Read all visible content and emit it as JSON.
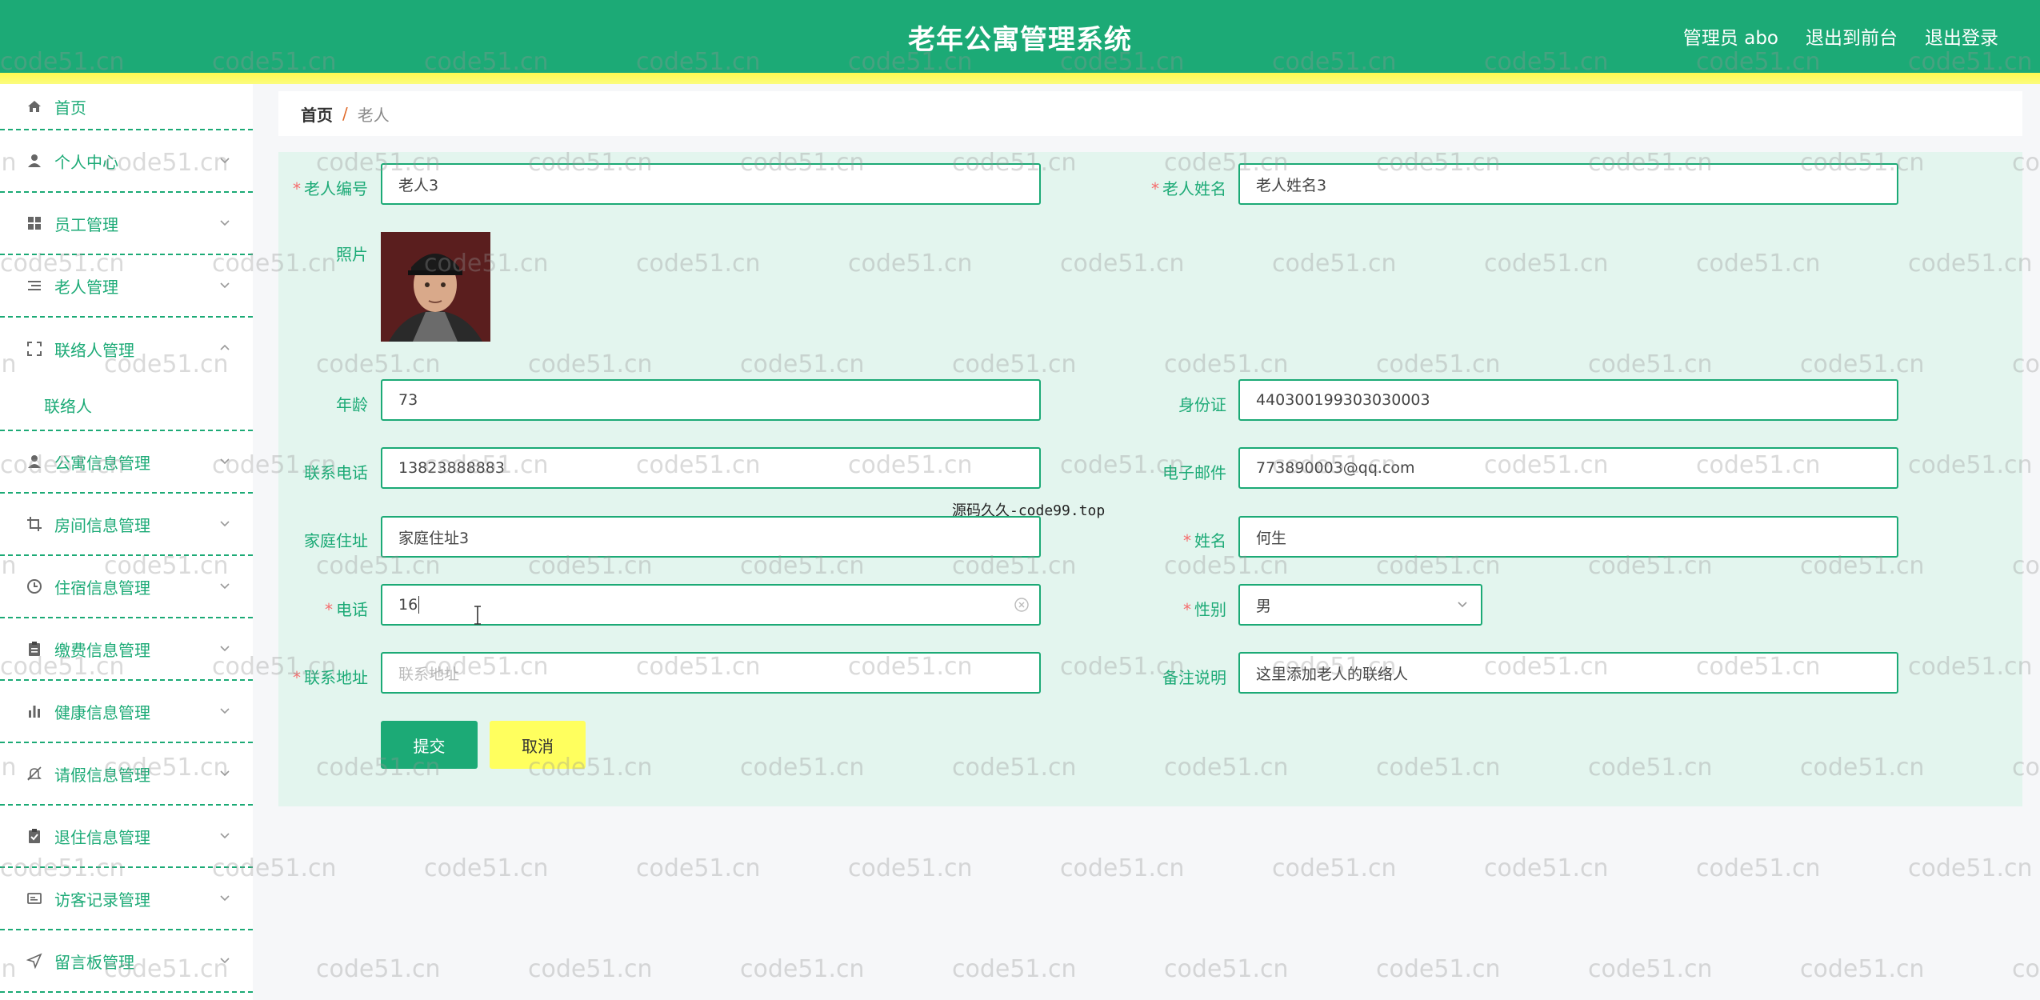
{
  "header": {
    "title": "老年公寓管理系统",
    "user": "管理员 abo",
    "to_front": "退出到前台",
    "logout": "退出登录"
  },
  "sidebar": {
    "items": [
      {
        "label": "首页",
        "icon": "home-icon"
      },
      {
        "label": "个人中心",
        "icon": "user-icon"
      },
      {
        "label": "员工管理",
        "icon": "grid-icon"
      },
      {
        "label": "老人管理",
        "icon": "list-icon"
      },
      {
        "label": "联络人管理",
        "icon": "fullscreen-icon",
        "expanded": true,
        "sub": [
          "联络人"
        ]
      },
      {
        "label": "公寓信息管理",
        "icon": "user-icon"
      },
      {
        "label": "房间信息管理",
        "icon": "crop-icon"
      },
      {
        "label": "住宿信息管理",
        "icon": "clock-icon"
      },
      {
        "label": "缴费信息管理",
        "icon": "clipboard-icon"
      },
      {
        "label": "健康信息管理",
        "icon": "bar-chart-icon"
      },
      {
        "label": "请假信息管理",
        "icon": "bell-off-icon"
      },
      {
        "label": "退住信息管理",
        "icon": "clipboard-check-icon"
      },
      {
        "label": "访客记录管理",
        "icon": "card-icon"
      },
      {
        "label": "留言板管理",
        "icon": "send-icon"
      }
    ]
  },
  "breadcrumb": {
    "home": "首页",
    "sep": "/",
    "current": "老人"
  },
  "form": {
    "elder_no": {
      "label": "老人编号",
      "value": "老人3"
    },
    "elder_name": {
      "label": "老人姓名",
      "value": "老人姓名3"
    },
    "photo": {
      "label": "照片"
    },
    "age": {
      "label": "年龄",
      "value": "73"
    },
    "id_card": {
      "label": "身份证",
      "value": "440300199303030003"
    },
    "phone": {
      "label": "联系电话",
      "value": "13823888883"
    },
    "email": {
      "label": "电子邮件",
      "value": "773890003@qq.com"
    },
    "address": {
      "label": "家庭住址",
      "value": "家庭住址3"
    },
    "contact_name": {
      "label": "姓名",
      "value": "何生"
    },
    "contact_phone": {
      "label": "电话",
      "value": "16"
    },
    "gender": {
      "label": "性别",
      "value": "男"
    },
    "contact_address": {
      "label": "联系地址",
      "placeholder": "联系地址"
    },
    "remark": {
      "label": "备注说明",
      "value": "这里添加老人的联络人"
    },
    "submit": "提交",
    "cancel": "取消"
  },
  "overlay_text": "源码久久-code99.top",
  "watermark": "code51.cn",
  "colors": {
    "primary": "#1caa76",
    "stripe": "#fff94f",
    "panel": "#e3f5ee",
    "cancel": "#ffff5e"
  }
}
